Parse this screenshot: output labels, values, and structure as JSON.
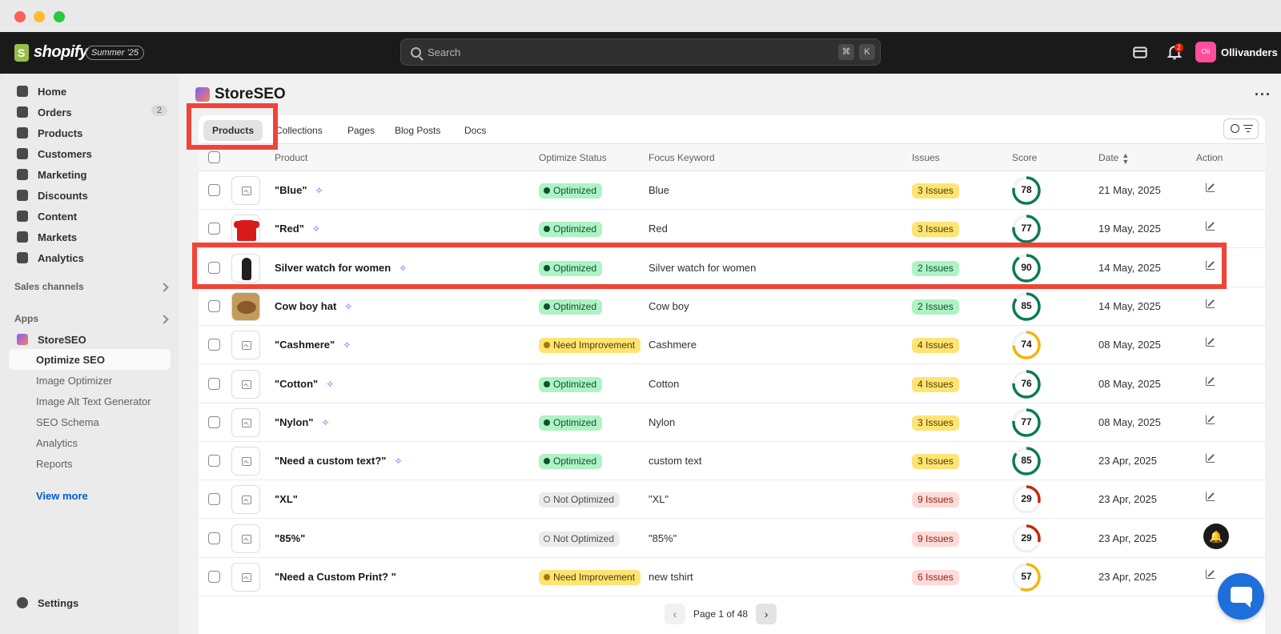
{
  "topbar": {
    "brand": "shopify",
    "edition": "Summer '25",
    "search_placeholder": "Search",
    "shortcut_keys": [
      "⌘",
      "K"
    ],
    "notification_count": "2",
    "store_initials": "OII",
    "store_name": "Ollivanders"
  },
  "sidebar": {
    "items": [
      {
        "label": "Home",
        "icon": "home-icon"
      },
      {
        "label": "Orders",
        "icon": "inbox-icon",
        "count": "2"
      },
      {
        "label": "Products",
        "icon": "tag-icon"
      },
      {
        "label": "Customers",
        "icon": "person-icon"
      },
      {
        "label": "Marketing",
        "icon": "target-icon"
      },
      {
        "label": "Discounts",
        "icon": "discount-icon"
      },
      {
        "label": "Content",
        "icon": "content-icon"
      },
      {
        "label": "Markets",
        "icon": "globe-icon"
      },
      {
        "label": "Analytics",
        "icon": "bar-chart-icon"
      }
    ],
    "sales_channels_label": "Sales channels",
    "apps_label": "Apps",
    "app_name": "StoreSEO",
    "app_sub_items": [
      "Optimize SEO",
      "Image Optimizer",
      "Image Alt Text Generator",
      "SEO Schema",
      "Analytics",
      "Reports"
    ],
    "view_more": "View more",
    "settings": "Settings"
  },
  "main": {
    "title": "StoreSEO",
    "tabs": [
      "Products",
      "Collections",
      "Pages",
      "Blog Posts",
      "Docs"
    ],
    "columns": [
      "Product",
      "Optimize Status",
      "Focus Keyword",
      "Issues",
      "Score",
      "Date",
      "Action"
    ],
    "rows": [
      {
        "name": "\"Blue\"",
        "sparkle": true,
        "thumb": "placeholder",
        "status": "Optimized",
        "status_kind": "ok",
        "keyword": "Blue",
        "issues": "3 Issues",
        "issues_kind": "amber",
        "score": "78",
        "score_value": 78,
        "score_color": "#0b7a55",
        "date": "21 May, 2025"
      },
      {
        "name": "\"Red\"",
        "sparkle": true,
        "thumb": "tshirt",
        "status": "Optimized",
        "status_kind": "ok",
        "keyword": "Red",
        "issues": "3 Issues",
        "issues_kind": "amber",
        "score": "77",
        "score_value": 77,
        "score_color": "#0b7a55",
        "date": "19 May, 2025"
      },
      {
        "name": "Silver watch for women",
        "sparkle": true,
        "thumb": "woman",
        "status": "Optimized",
        "status_kind": "ok",
        "keyword": "Silver watch for women",
        "issues": "2 Issues",
        "issues_kind": "green",
        "score": "90",
        "score_value": 90,
        "score_color": "#0b7a55",
        "date": "14 May, 2025"
      },
      {
        "name": "Cow boy hat",
        "sparkle": true,
        "thumb": "hat",
        "status": "Optimized",
        "status_kind": "ok",
        "keyword": "Cow boy",
        "issues": "2 Issues",
        "issues_kind": "green",
        "score": "85",
        "score_value": 85,
        "score_color": "#0b7a55",
        "date": "14 May, 2025"
      },
      {
        "name": "\"Cashmere\"",
        "sparkle": true,
        "thumb": "placeholder",
        "status": "Need Improvement",
        "status_kind": "warn",
        "keyword": "Cashmere",
        "issues": "4 Issues",
        "issues_kind": "amber",
        "score": "74",
        "score_value": 74,
        "score_color": "#f5b40a",
        "date": "08 May, 2025"
      },
      {
        "name": "\"Cotton\"",
        "sparkle": true,
        "thumb": "placeholder",
        "status": "Optimized",
        "status_kind": "ok",
        "keyword": "Cotton",
        "issues": "4 Issues",
        "issues_kind": "amber",
        "score": "76",
        "score_value": 76,
        "score_color": "#0b7a55",
        "date": "08 May, 2025"
      },
      {
        "name": "\"Nylon\"",
        "sparkle": true,
        "thumb": "placeholder",
        "status": "Optimized",
        "status_kind": "ok",
        "keyword": "Nylon",
        "issues": "3 Issues",
        "issues_kind": "amber",
        "score": "77",
        "score_value": 77,
        "score_color": "#0b7a55",
        "date": "08 May, 2025"
      },
      {
        "name": "\"Need a custom text?\"",
        "sparkle": true,
        "thumb": "placeholder",
        "status": "Optimized",
        "status_kind": "ok",
        "keyword": "custom text",
        "issues": "3 Issues",
        "issues_kind": "amber",
        "score": "85",
        "score_value": 85,
        "score_color": "#0b7a55",
        "date": "23 Apr, 2025"
      },
      {
        "name": "\"XL\"",
        "sparkle": false,
        "thumb": "placeholder",
        "status": "Not Optimized",
        "status_kind": "not",
        "keyword": "\"XL\"",
        "issues": "9 Issues",
        "issues_kind": "red",
        "score": "29",
        "score_value": 29,
        "score_color": "#c5280c",
        "date": "23 Apr, 2025"
      },
      {
        "name": "\"85%\"",
        "sparkle": false,
        "thumb": "placeholder",
        "status": "Not Optimized",
        "status_kind": "not",
        "keyword": "\"85%\"",
        "issues": "9 Issues",
        "issues_kind": "red",
        "score": "29",
        "score_value": 29,
        "score_color": "#c5280c",
        "date": "23 Apr, 2025"
      },
      {
        "name": "\"Need a Custom Print? \"",
        "sparkle": false,
        "thumb": "placeholder",
        "status": "Need Improvement",
        "status_kind": "warn",
        "keyword": "new tshirt",
        "issues": "6 Issues",
        "issues_kind": "red",
        "score": "57",
        "score_value": 57,
        "score_color": "#f5b40a",
        "date": "23 Apr, 2025"
      }
    ],
    "pagination": "Page 1 of 48"
  }
}
